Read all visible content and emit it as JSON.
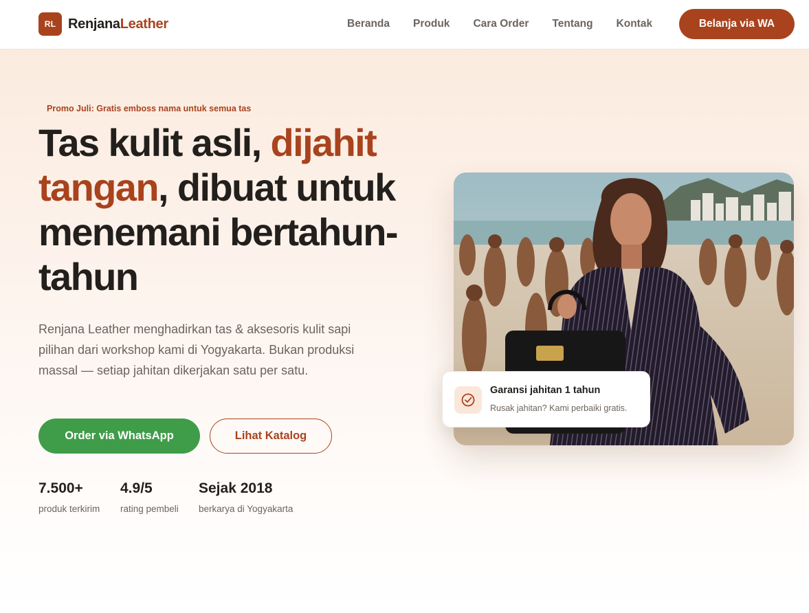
{
  "header": {
    "logo_badge": "RL",
    "brand_part1": "Renjana",
    "brand_part2": "Leather",
    "nav": [
      "Beranda",
      "Produk",
      "Cara Order",
      "Tentang",
      "Kontak"
    ],
    "cta": "Belanja via WA"
  },
  "hero": {
    "promo": "Promo Juli: Gratis emboss nama untuk semua tas",
    "headline_part1": "Tas kulit asli, ",
    "headline_accent": "dijahit tangan",
    "headline_part2": ", dibuat untuk menemani bertahun-tahun",
    "lead": "Renjana Leather menghadirkan tas & aksesoris kulit sapi pilihan dari workshop kami di Yogyakarta. Bukan produksi massal — setiap jahitan dikerjakan satu per satu.",
    "btn_primary": "Order via WhatsApp",
    "btn_secondary": "Lihat Katalog",
    "stats": [
      {
        "value": "7.500+",
        "label": "produk terkirim"
      },
      {
        "value": "4.9/5",
        "label": "rating pembeli"
      },
      {
        "value": "Sejak 2018",
        "label": "berkarya di Yogyakarta"
      }
    ],
    "guarantee": {
      "icon": "check-circle-icon",
      "title": "Garansi jahitan 1 tahun",
      "text": "Rusak jahitan? Kami perbaiki gratis."
    }
  },
  "colors": {
    "brand": "#a8431e",
    "whatsapp": "#3f9c49",
    "text": "#221f1c",
    "muted": "#6b645e",
    "hero_bg": "#fbebdf"
  }
}
